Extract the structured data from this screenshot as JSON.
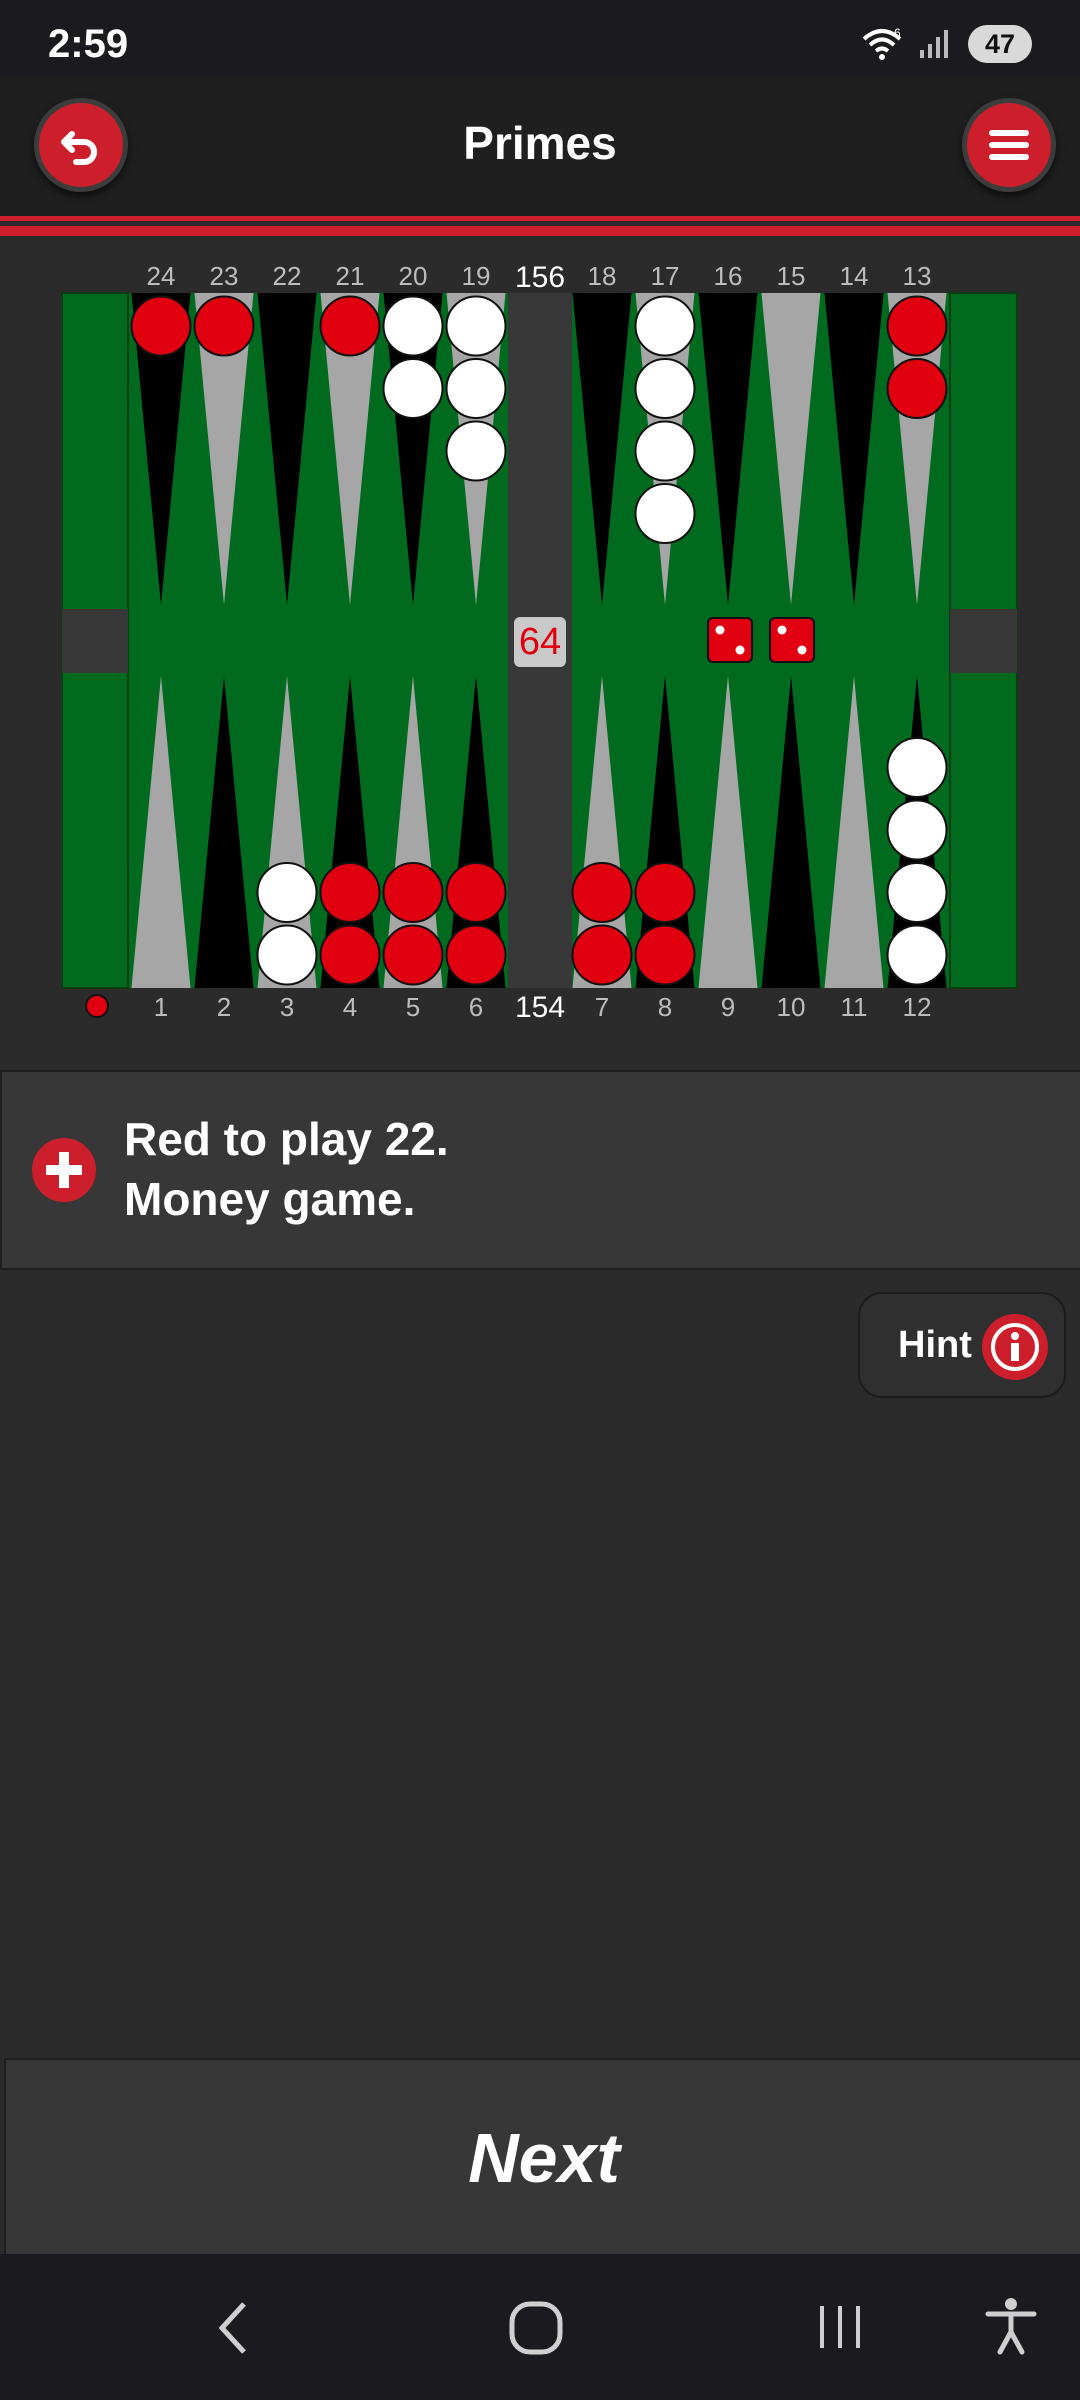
{
  "status_bar": {
    "time": "2:59",
    "battery": "47",
    "wifi_badge": "6"
  },
  "app_bar": {
    "title": "Primes",
    "back_icon": "undo-arrow-icon",
    "menu_icon": "hamburger-menu-icon"
  },
  "board": {
    "pip_count_top": "156",
    "pip_count_bottom": "154",
    "cube_value": "64",
    "dice": [
      2,
      2
    ],
    "top_points": [
      "24",
      "23",
      "22",
      "21",
      "20",
      "19",
      "18",
      "17",
      "16",
      "15",
      "14",
      "13"
    ],
    "bottom_points": [
      "1",
      "2",
      "3",
      "4",
      "5",
      "6",
      "7",
      "8",
      "9",
      "10",
      "11",
      "12"
    ],
    "checkers": [
      {
        "point": 3,
        "color": "white",
        "count": 2
      },
      {
        "point": 4,
        "color": "red",
        "count": 2
      },
      {
        "point": 5,
        "color": "red",
        "count": 2
      },
      {
        "point": 6,
        "color": "red",
        "count": 2
      },
      {
        "point": 7,
        "color": "red",
        "count": 2
      },
      {
        "point": 8,
        "color": "red",
        "count": 2
      },
      {
        "point": 12,
        "color": "white",
        "count": 4
      },
      {
        "point": 13,
        "color": "red",
        "count": 2
      },
      {
        "point": 17,
        "color": "white",
        "count": 4
      },
      {
        "point": 19,
        "color": "white",
        "count": 3
      },
      {
        "point": 20,
        "color": "white",
        "count": 2
      },
      {
        "point": 21,
        "color": "red",
        "count": 1
      },
      {
        "point": 23,
        "color": "red",
        "count": 1
      },
      {
        "point": 24,
        "color": "red",
        "count": 1
      }
    ],
    "turn_indicator_color": "red",
    "colors": {
      "felt": "#006b1e",
      "red": "#e0000f",
      "white": "#ffffff",
      "dark_point": "#000000",
      "light_point": "#a6a6a6",
      "bar": "#383838"
    }
  },
  "message": {
    "line1": "Red to play 22.",
    "line2": "Money game.",
    "icon": "plus-icon"
  },
  "hint": {
    "label": "Hint",
    "icon": "info-icon"
  },
  "next_button": {
    "label": "Next"
  },
  "nav_bar": {
    "back": "back-chevron-icon",
    "home": "home-circle-icon",
    "recents": "recents-bars-icon",
    "accessibility": "accessibility-icon"
  }
}
